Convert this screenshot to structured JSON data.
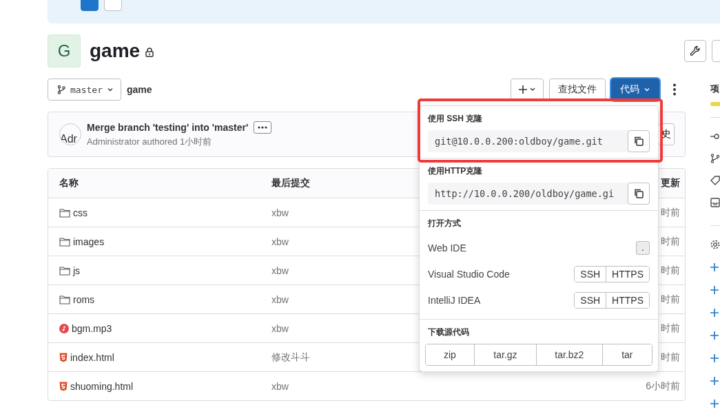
{
  "banner": {
    "buttons": [
      {
        "primary": true
      },
      {
        "primary": false
      }
    ]
  },
  "project": {
    "avatar_letter": "G",
    "name": "game",
    "private": true
  },
  "branch": {
    "name": "master"
  },
  "path": "game",
  "actions": {
    "find_file": "查找文件",
    "code": "代码"
  },
  "commit": {
    "title": "Merge branch 'testing' into 'master'",
    "avatar_alt": "Adr",
    "meta": "Administrator authored 1小时前",
    "history_button": "史"
  },
  "table": {
    "columns": [
      "名称",
      "最后提交",
      "更新"
    ],
    "rows": [
      {
        "name": "css",
        "kind": "folder",
        "commit": "xbw",
        "updated": "时前"
      },
      {
        "name": "images",
        "kind": "folder",
        "commit": "xbw",
        "updated": "时前"
      },
      {
        "name": "js",
        "kind": "folder",
        "commit": "xbw",
        "updated": "时前"
      },
      {
        "name": "roms",
        "kind": "folder",
        "commit": "xbw",
        "updated": "时前"
      },
      {
        "name": "bgm.mp3",
        "kind": "audio",
        "commit": "xbw",
        "updated": "时前"
      },
      {
        "name": "index.html",
        "kind": "html",
        "commit": "修改斗斗",
        "updated": "时前"
      },
      {
        "name": "shuoming.html",
        "kind": "html",
        "commit": "xbw",
        "updated": "6小时前"
      }
    ]
  },
  "clone_menu": {
    "highlighted": true,
    "clone": [
      {
        "title": "使用 SSH 克隆",
        "url": "git@10.0.0.200:oldboy/game.git"
      },
      {
        "title": "使用HTTP克隆",
        "url": "http://10.0.0.200/oldboy/game.gi"
      }
    ],
    "open_title": "打开方式",
    "open_with": [
      {
        "name": "Web IDE",
        "kind": "shortcut",
        "options": [
          "."
        ]
      },
      {
        "name": "Visual Studio Code",
        "kind": "protocols",
        "options": [
          "SSH",
          "HTTPS"
        ]
      },
      {
        "name": "IntelliJ IDEA",
        "kind": "protocols",
        "options": [
          "SSH",
          "HTTPS"
        ]
      }
    ],
    "download_title": "下载源代码",
    "formats": [
      "zip",
      "tar.gz",
      "tar.bz2",
      "tar"
    ]
  },
  "sidebar": {
    "heading": "项"
  }
}
